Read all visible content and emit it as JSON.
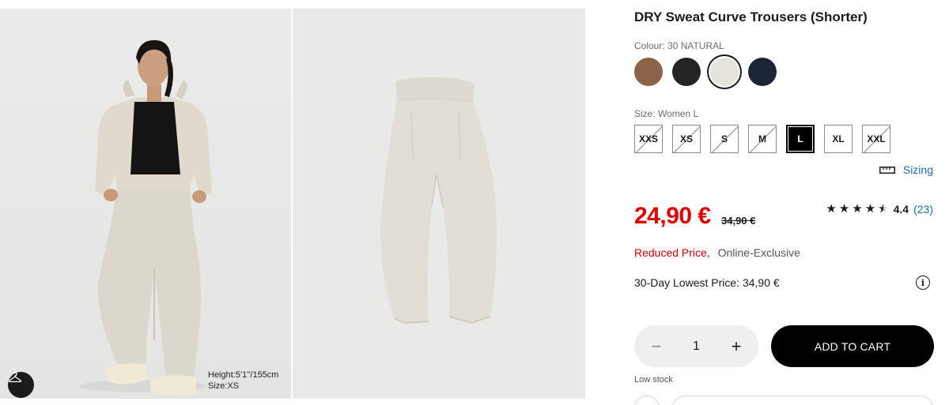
{
  "gallery": {
    "model_info": {
      "height": "Height:5'1''/155cm",
      "size": "Size:XS"
    },
    "hanger_icon": "hanger-icon"
  },
  "product": {
    "title": "DRY Sweat Curve Trousers (Shorter)",
    "colour_label": "Colour: 30 NATURAL",
    "colours": [
      {
        "name": "brown",
        "hex": "#8b6347",
        "selected": false
      },
      {
        "name": "black",
        "hex": "#242424",
        "selected": false
      },
      {
        "name": "natural",
        "hex": "#e6e2dc",
        "selected": true
      },
      {
        "name": "navy",
        "hex": "#1b2538",
        "selected": false
      }
    ],
    "size_label": "Size: Women L",
    "sizes": [
      {
        "label": "XXS",
        "available": false,
        "selected": false
      },
      {
        "label": "XS",
        "available": false,
        "selected": false
      },
      {
        "label": "S",
        "available": false,
        "selected": false
      },
      {
        "label": "M",
        "available": false,
        "selected": false
      },
      {
        "label": "L",
        "available": true,
        "selected": true
      },
      {
        "label": "XL",
        "available": true,
        "selected": false
      },
      {
        "label": "XXL",
        "available": false,
        "selected": false
      }
    ],
    "sizing_link": "Sizing",
    "price": "24,90 €",
    "original_price": "34,90 €",
    "rating": {
      "value": "4.4",
      "count": "(23)",
      "stars": 4.5
    },
    "promo": {
      "reduced": "Reduced Price,",
      "online": "Online-Exclusive"
    },
    "lowest_price": "30-Day Lowest Price: 34,90 €",
    "quantity": {
      "minus": "−",
      "value": "1",
      "plus": "+"
    },
    "add_to_cart": "ADD TO CART",
    "stock": "Low stock"
  },
  "colors": {
    "sale_red": "#e10000",
    "link_blue": "#1a6fb5",
    "primary_black": "#000000"
  }
}
